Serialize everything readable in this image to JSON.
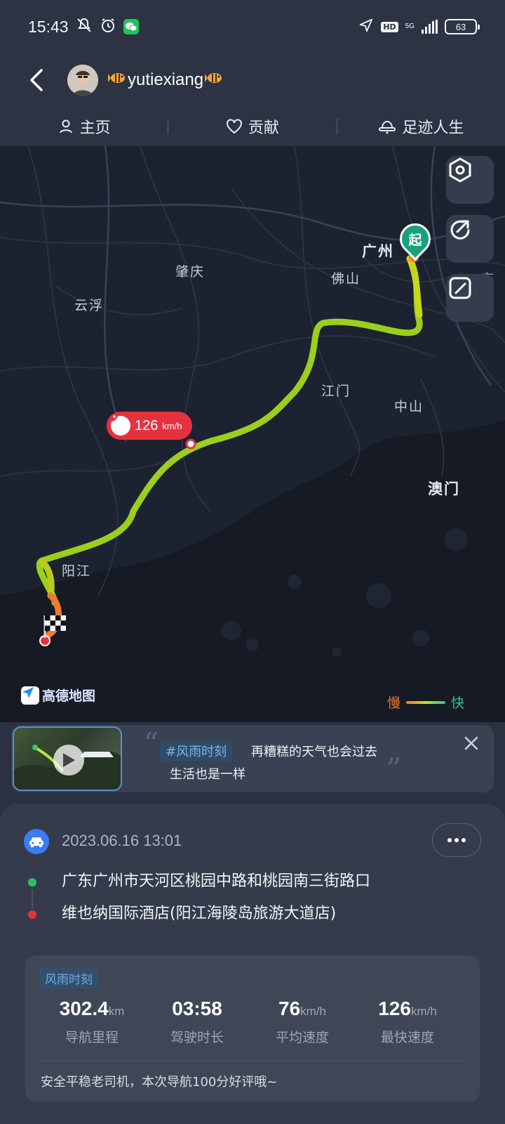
{
  "status_bar": {
    "time": "15:43",
    "network": "5G",
    "hd": "HD",
    "battery": "63"
  },
  "header": {
    "username": "yutiexiang"
  },
  "tabs": [
    {
      "label": "主页",
      "icon": "person-icon"
    },
    {
      "label": "贡献",
      "icon": "heart-icon"
    },
    {
      "label": "足迹人生",
      "icon": "footprint-icon"
    }
  ],
  "map": {
    "cities": {
      "guangzhou": "广州",
      "foshan": "佛山",
      "zhaoqing": "肇庆",
      "yunfu": "云浮",
      "jiangmen": "江门",
      "zhongshan": "中山",
      "macau": "澳门",
      "yangjiang": "阳江",
      "dongguan": "东莞"
    },
    "start_marker": "起",
    "max_speed_value": "126",
    "max_speed_unit": "km/h",
    "logo": "高德地图",
    "legend": {
      "slow": "慢",
      "fast": "快"
    }
  },
  "video_card": {
    "tag": "#风雨时刻",
    "line1": "再糟糕的天气也会过去",
    "line2": "生活也是一样"
  },
  "trip": {
    "datetime": "2023.06.16 13:01",
    "from": "广东广州市天河区桃园中路和桃园南三街路口",
    "to": "维也纳国际酒店(阳江海陵岛旅游大道店)",
    "tag": "风雨时刻",
    "stats": [
      {
        "value": "302.4",
        "unit": "km",
        "label": "导航里程"
      },
      {
        "value": "03:58",
        "unit": "",
        "label": "驾驶时长"
      },
      {
        "value": "76",
        "unit": "km/h",
        "label": "平均速度"
      },
      {
        "value": "126",
        "unit": "km/h",
        "label": "最快速度"
      }
    ],
    "footer": "安全平稳老司机，本次导航100分好评哦~"
  },
  "colors": {
    "start_green": "#17a27a",
    "end_red": "#e5323f",
    "route_fast": "#9ccf1c",
    "accent_blue": "#3b7cf0"
  }
}
